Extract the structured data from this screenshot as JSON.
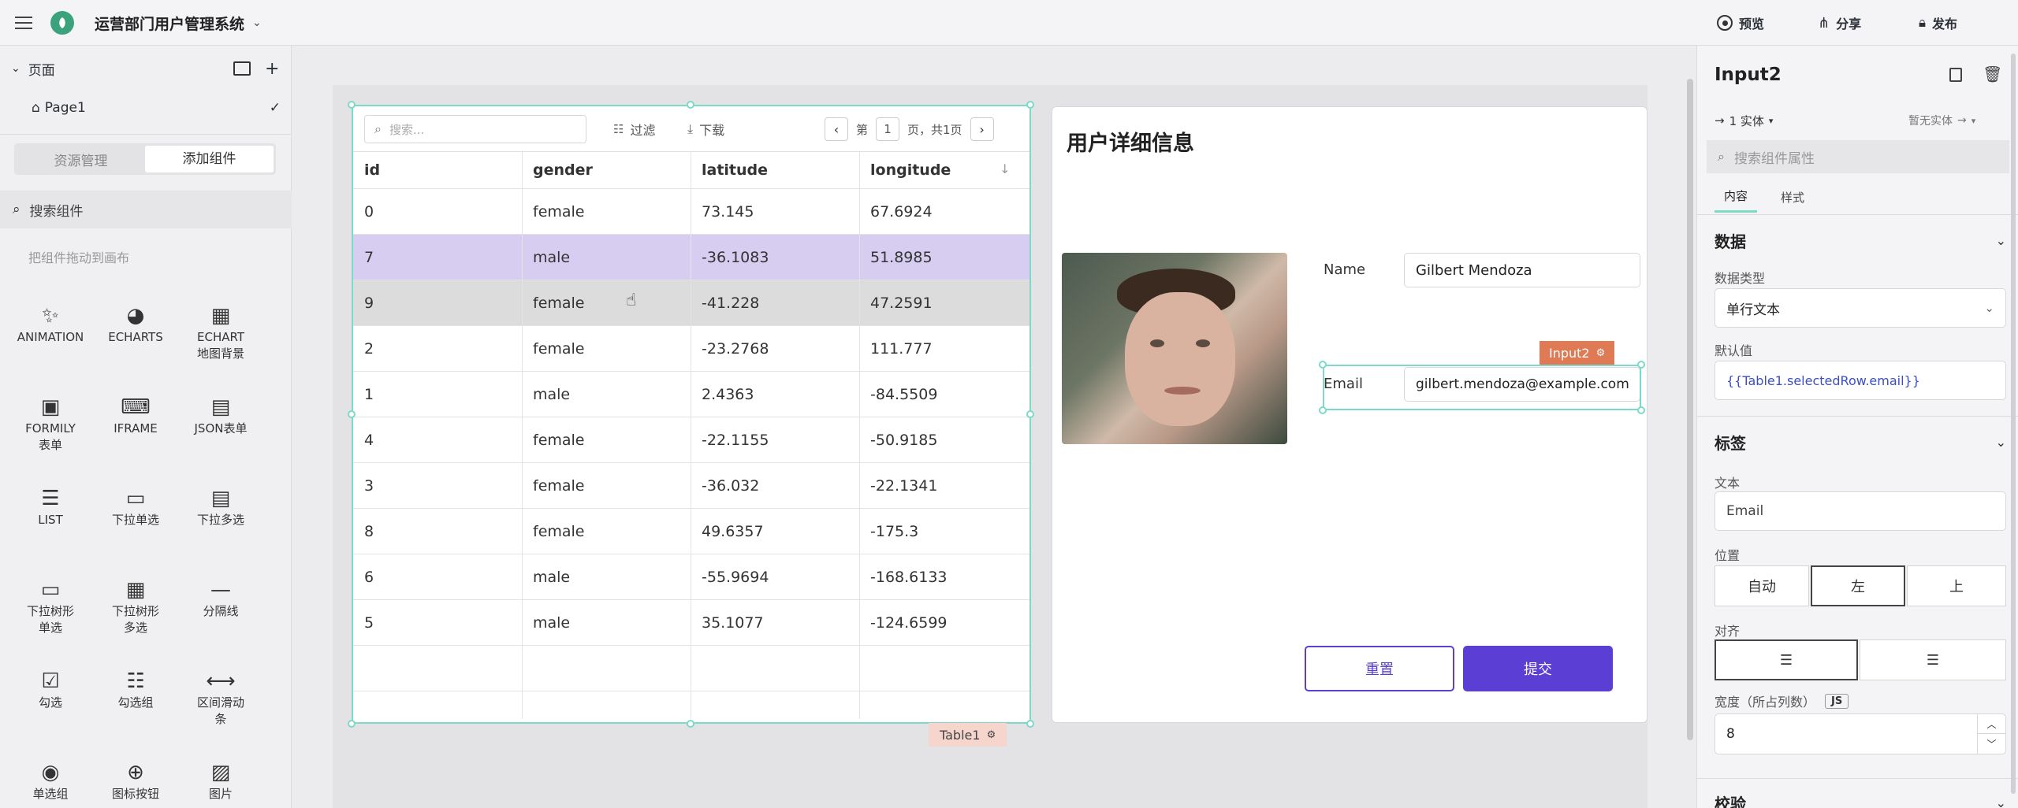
{
  "app": {
    "title": "运营部门用户管理系统",
    "actions": [
      {
        "label": "预览",
        "icon": "preview-icon"
      },
      {
        "label": "分享",
        "icon": "share-icon"
      },
      {
        "label": "发布",
        "icon": "lock-icon"
      }
    ]
  },
  "left": {
    "pages_title": "页面",
    "page_item": "Page1",
    "tabs": [
      "资源管理",
      "添加组件"
    ],
    "search_placeholder": "搜索组件",
    "hint": "把组件拖动到画布",
    "components": [
      {
        "label": "ANIMATION",
        "icon": "sparkle-icon"
      },
      {
        "label": "ECHARTS",
        "icon": "echarts-icon"
      },
      {
        "label": "ECHART\n地图背景",
        "icon": "echart-map-icon"
      },
      {
        "label": "FORMILY\n表单",
        "icon": "formily-icon"
      },
      {
        "label": "IFRAME",
        "icon": "iframe-icon"
      },
      {
        "label": "JSON表单",
        "icon": "json-form-icon"
      },
      {
        "label": "LIST",
        "icon": "list-icon"
      },
      {
        "label": "下拉单选",
        "icon": "select-icon"
      },
      {
        "label": "下拉多选",
        "icon": "multi-select-icon"
      },
      {
        "label": "下拉树形\n单选",
        "icon": "tree-select-icon"
      },
      {
        "label": "下拉树形\n多选",
        "icon": "tree-multi-select-icon"
      },
      {
        "label": "分隔线",
        "icon": "divider-icon"
      },
      {
        "label": "勾选",
        "icon": "checkbox-icon"
      },
      {
        "label": "勾选组",
        "icon": "checkbox-group-icon"
      },
      {
        "label": "区间滑动\n条",
        "icon": "range-slider-icon"
      },
      {
        "label": "单选组",
        "icon": "radio-group-icon"
      },
      {
        "label": "图标按钮",
        "icon": "icon-button-icon"
      },
      {
        "label": "图片",
        "icon": "image-icon"
      }
    ]
  },
  "table": {
    "search_placeholder": "搜索...",
    "filter_label": "过滤",
    "download_label": "下载",
    "page_prefix": "第",
    "page_num": "1",
    "page_suffix": "页，共1页",
    "columns": [
      "id",
      "gender",
      "latitude",
      "longitude"
    ],
    "rows": [
      [
        "0",
        "female",
        "73.145",
        "67.6924"
      ],
      [
        "7",
        "male",
        "-36.1083",
        "51.8985"
      ],
      [
        "9",
        "female",
        "-41.228",
        "47.2591"
      ],
      [
        "2",
        "female",
        "-23.2768",
        "111.777"
      ],
      [
        "1",
        "male",
        "2.4363",
        "-84.5509"
      ],
      [
        "4",
        "female",
        "-22.1155",
        "-50.9185"
      ],
      [
        "3",
        "female",
        "-36.032",
        "-22.1341"
      ],
      [
        "8",
        "female",
        "49.6357",
        "-175.3"
      ],
      [
        "6",
        "male",
        "-55.9694",
        "-168.6133"
      ],
      [
        "5",
        "male",
        "35.1077",
        "-124.6599"
      ]
    ],
    "selected_row": 1,
    "hover_row": 2,
    "tag": "Table1"
  },
  "detail": {
    "title": "用户详细信息",
    "name_label": "Name",
    "name_value": "Gilbert Mendoza",
    "email_label": "Email",
    "email_value": "gilbert.mendoza@example.com",
    "input_tag": "Input2",
    "reset_label": "重置",
    "submit_label": "提交"
  },
  "inspector": {
    "name": "Input2",
    "entity": "1 实体",
    "no_entity": "暂无实体",
    "search_placeholder": "搜索组件属性",
    "tabs": [
      "内容",
      "样式"
    ],
    "data_section": "数据",
    "data_type_label": "数据类型",
    "data_type_value": "单行文本",
    "default_label": "默认值",
    "default_value": "{{Table1.selectedRow.email}}",
    "label_section": "标签",
    "text_label": "文本",
    "text_value": "Email",
    "position_label": "位置",
    "position_options": [
      "自动",
      "左",
      "上"
    ],
    "align_label": "对齐",
    "width_label": "宽度（所占列数）",
    "js_badge": "JS",
    "width_value": "8",
    "validate_section": "校验"
  },
  "colors": {
    "accent": "#5b3fd4",
    "selected_row": "#d6cdf0",
    "hover_row": "#dcdcdc",
    "selection_outline": "#7dd9c8",
    "input_tag": "#e07a54",
    "table_tag": "#f6d6cc"
  }
}
